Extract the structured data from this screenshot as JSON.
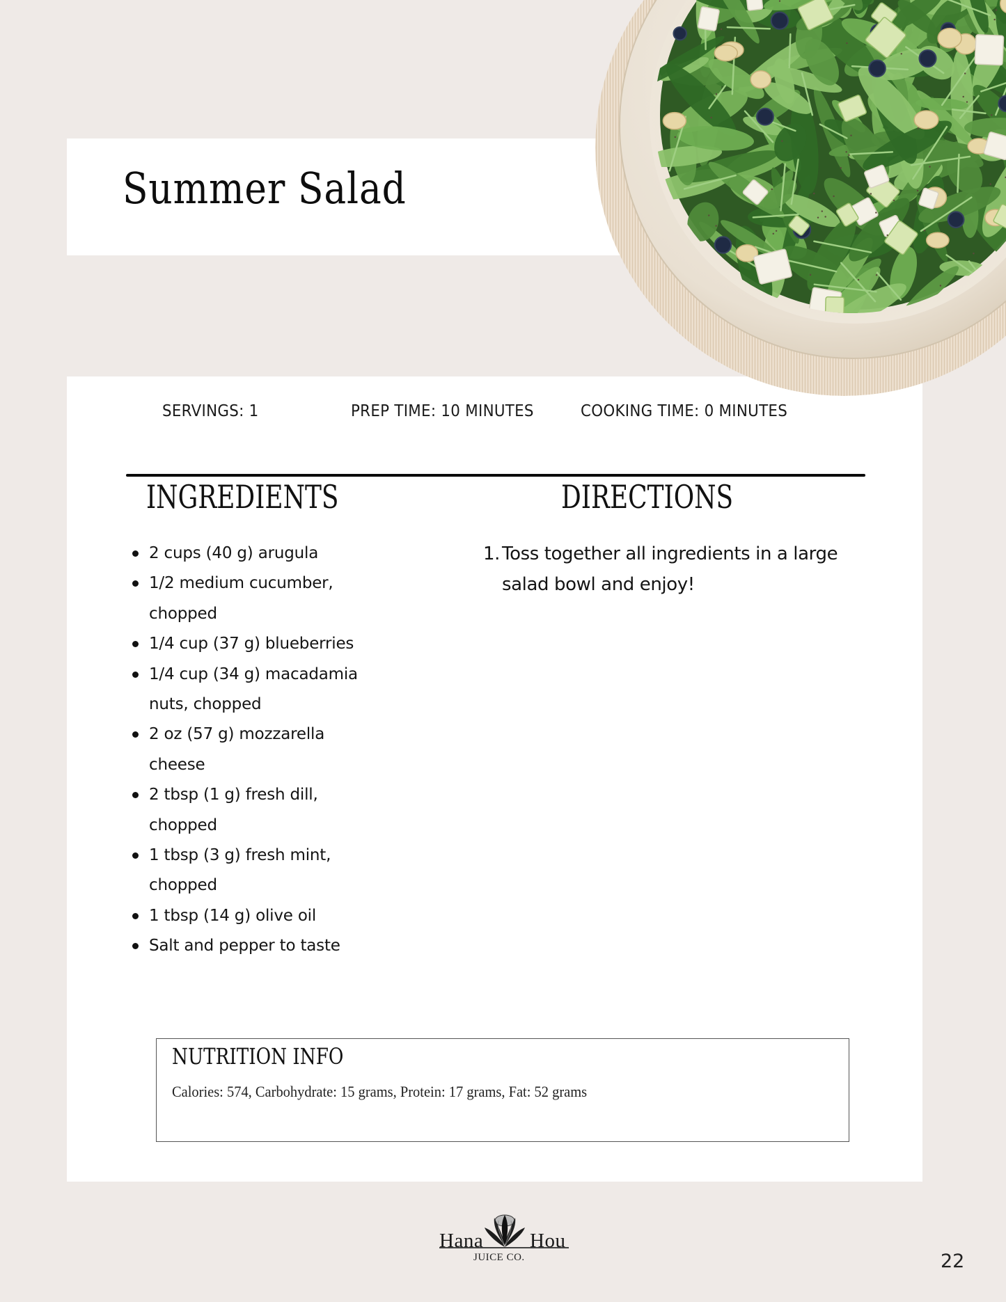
{
  "recipe": {
    "title": "Summer Salad",
    "photo_alt": "Bowl of arugula salad with cucumber, blueberries, macadamia nuts and mozzarella",
    "meta": {
      "servings": "SERVINGS: 1",
      "prep_time": "PREP TIME: 10 MINUTES",
      "cooking_time": "COOKING TIME: 0 MINUTES"
    },
    "ingredients_heading": "INGREDIENTS",
    "ingredients": [
      "2 cups (40 g) arugula",
      "1/2 medium cucumber, chopped",
      "1/4 cup (37 g) blueberries",
      "1/4 cup (34 g) macadamia nuts, chopped",
      "2 oz (57 g) mozzarella cheese",
      "2 tbsp (1 g) fresh dill, chopped",
      "1 tbsp (3 g) fresh mint, chopped",
      "1 tbsp (14 g) olive oil",
      "Salt and pepper to taste"
    ],
    "directions_heading": "DIRECTIONS",
    "directions": [
      {
        "number": "1.",
        "text": "Toss together all ingredients in a large salad bowl and enjoy!"
      }
    ],
    "nutrition": {
      "heading": "NUTRITION INFO",
      "text": "Calories: 574, Carbohydrate: 15 grams, Protein: 17 grams, Fat: 52 grams"
    }
  },
  "footer": {
    "logo": {
      "word_left": "Hana",
      "word_right": "Hou",
      "subtitle": "JUICE CO.",
      "icon": "protea-flower-icon"
    },
    "page_number": "22"
  },
  "colors": {
    "page_background": "#efeae7",
    "card_background": "#ffffff",
    "text": "#111111",
    "placemat": "#e6d6c2",
    "bowl": "#ece4d6",
    "arugula": "#4f8a3a"
  }
}
